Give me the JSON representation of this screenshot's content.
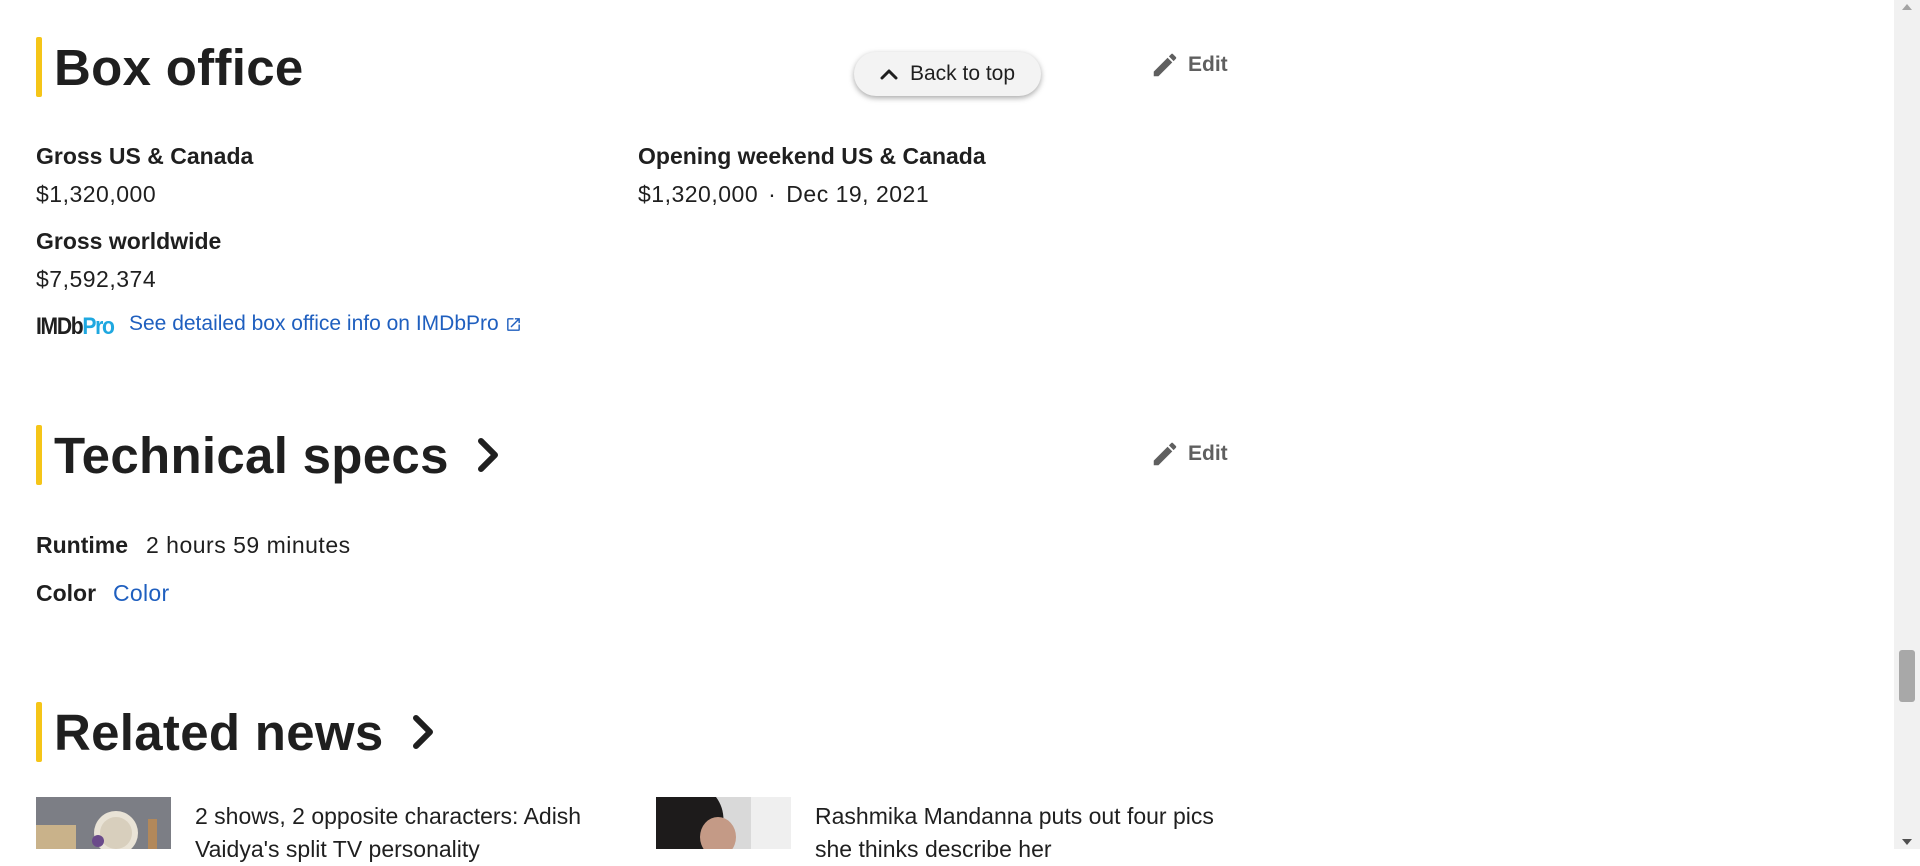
{
  "back_to_top": "Back to top",
  "box_office": {
    "title": "Box office",
    "edit_label": "Edit",
    "gross_us_label": "Gross US & Canada",
    "gross_us_value": "$1,320,000",
    "opening_label": "Opening weekend US & Canada",
    "opening_value": "$1,320,000",
    "opening_sep": "·",
    "opening_date": "Dec 19, 2021",
    "gross_world_label": "Gross worldwide",
    "gross_world_value": "$7,592,374",
    "imdbpro_logo_imdb": "IMDb",
    "imdbpro_logo_pro": "Pro",
    "imdbpro_link": "See detailed box office info on IMDbPro"
  },
  "tech_specs": {
    "title": "Technical specs",
    "edit_label": "Edit",
    "runtime_label": "Runtime",
    "runtime_value": "2 hours 59 minutes",
    "color_label": "Color",
    "color_value": "Color"
  },
  "related_news": {
    "title": "Related news",
    "items": [
      {
        "text": "2 shows, 2 opposite characters: Adish Vaidya's split TV personality"
      },
      {
        "text": "Rashmika Mandanna puts out four pics she thinks describe her"
      }
    ]
  },
  "colors": {
    "accent": "#f5c518",
    "link": "#1f5fbf",
    "pro": "#1fa8e0"
  }
}
